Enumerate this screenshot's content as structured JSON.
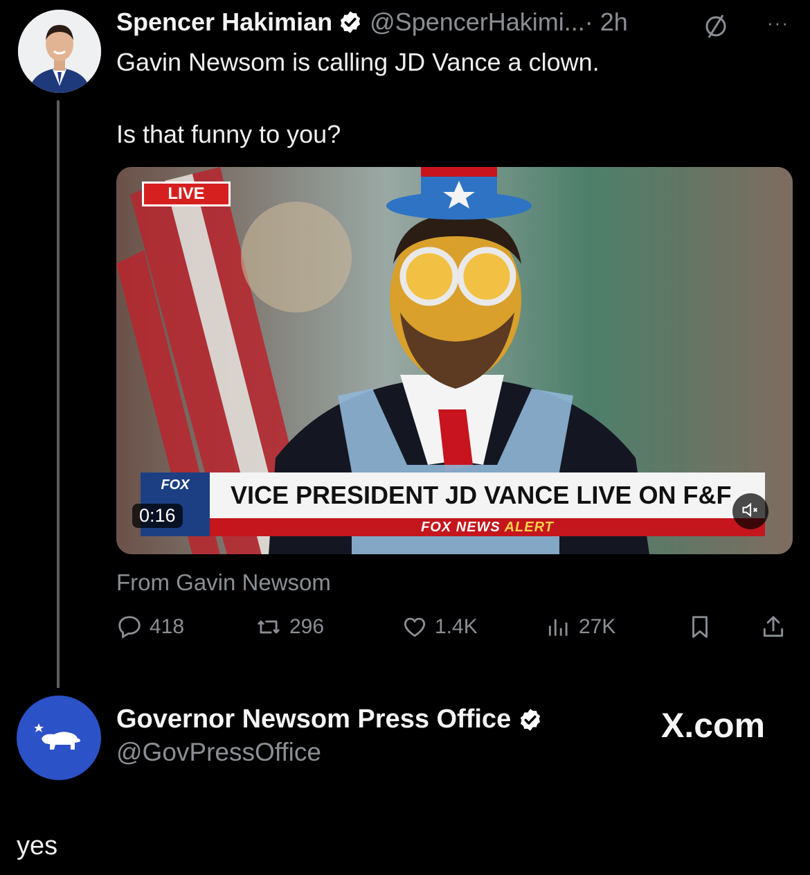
{
  "tweet": {
    "author_name": "Spencer Hakimian",
    "author_handle": "@SpencerHakimi...",
    "time": "· 2h",
    "more": "···",
    "text": "Gavin Newsom is calling JD Vance a clown.\n\nIs that funny to you?",
    "video": {
      "live_badge": "LIVE",
      "duration": "0:16",
      "logo_text": "FOX",
      "headline": "VICE PRESIDENT JD VANCE LIVE ON F&F",
      "alert_brand": "FOX NEWS",
      "alert_word": "ALERT"
    },
    "source": "From Gavin Newsom",
    "stats": {
      "replies": "418",
      "reposts": "296",
      "likes": "1.4K",
      "views": "27K"
    }
  },
  "quoted_account": {
    "name": "Governor Newsom Press Office",
    "handle": "@GovPressOffice",
    "watermark": "X.com"
  },
  "caption": "yes",
  "colors": {
    "background": "#000000",
    "verified_blue": "#1d9bf0",
    "muted_text": "#8b8f94",
    "gov_avatar_blue": "#2c52c7"
  },
  "icons": [
    "verified-badge-icon",
    "no-circle-icon",
    "more-icon",
    "reply-icon",
    "repost-icon",
    "like-icon",
    "views-icon",
    "bookmark-icon",
    "share-icon",
    "mute-icon",
    "bear-icon"
  ]
}
